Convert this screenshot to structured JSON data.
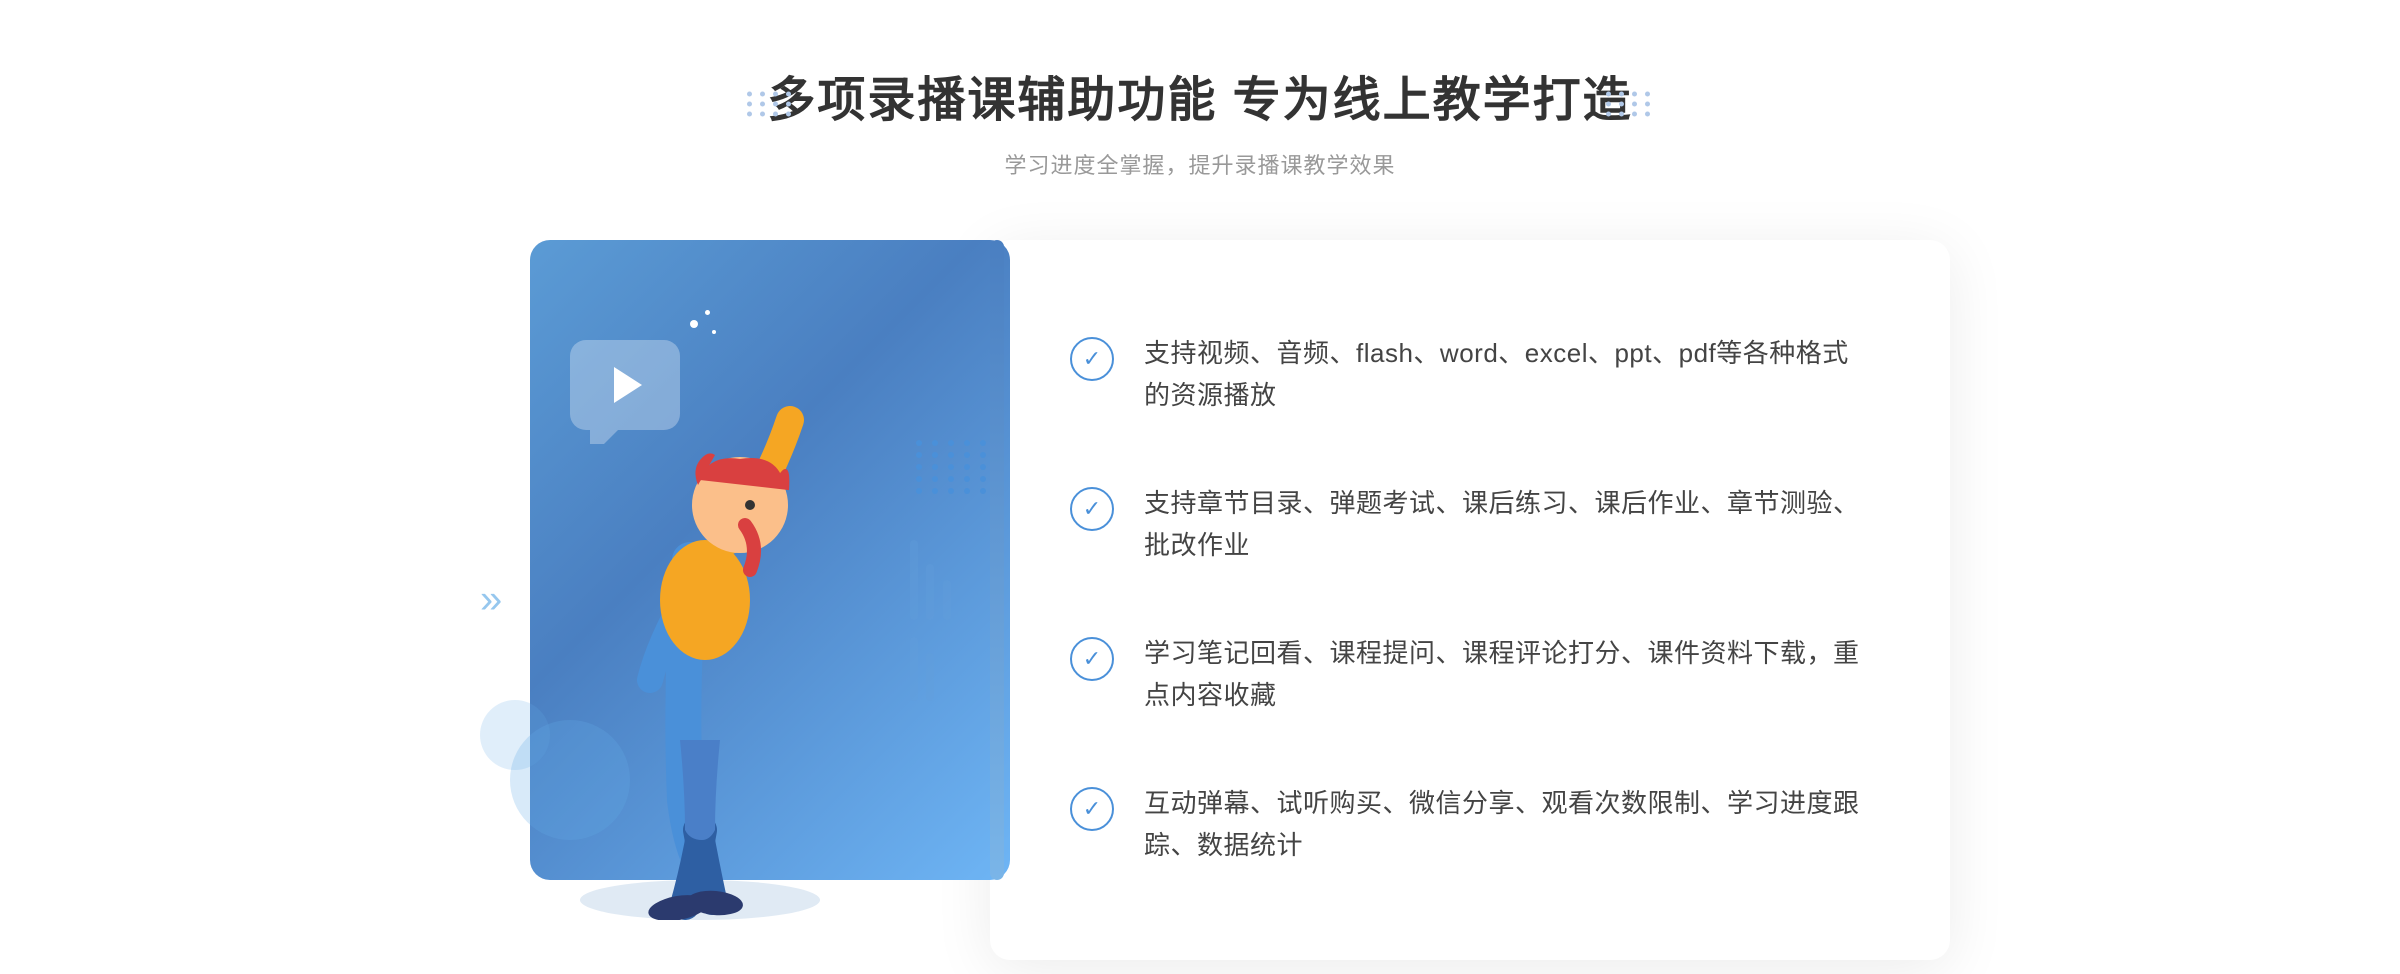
{
  "header": {
    "main_title": "多项录播课辅助功能 专为线上教学打造",
    "sub_title": "学习进度全掌握，提升录播课教学效果"
  },
  "features": [
    {
      "id": 1,
      "text": "支持视频、音频、flash、word、excel、ppt、pdf等各种格式的资源播放"
    },
    {
      "id": 2,
      "text": "支持章节目录、弹题考试、课后练习、课后作业、章节测验、批改作业"
    },
    {
      "id": 3,
      "text": "学习笔记回看、课程提问、课程评论打分、课件资料下载，重点内容收藏"
    },
    {
      "id": 4,
      "text": "互动弹幕、试听购买、微信分享、观看次数限制、学习进度跟踪、数据统计"
    }
  ],
  "decorative": {
    "arrows_left": "»",
    "check_symbol": "✓"
  }
}
